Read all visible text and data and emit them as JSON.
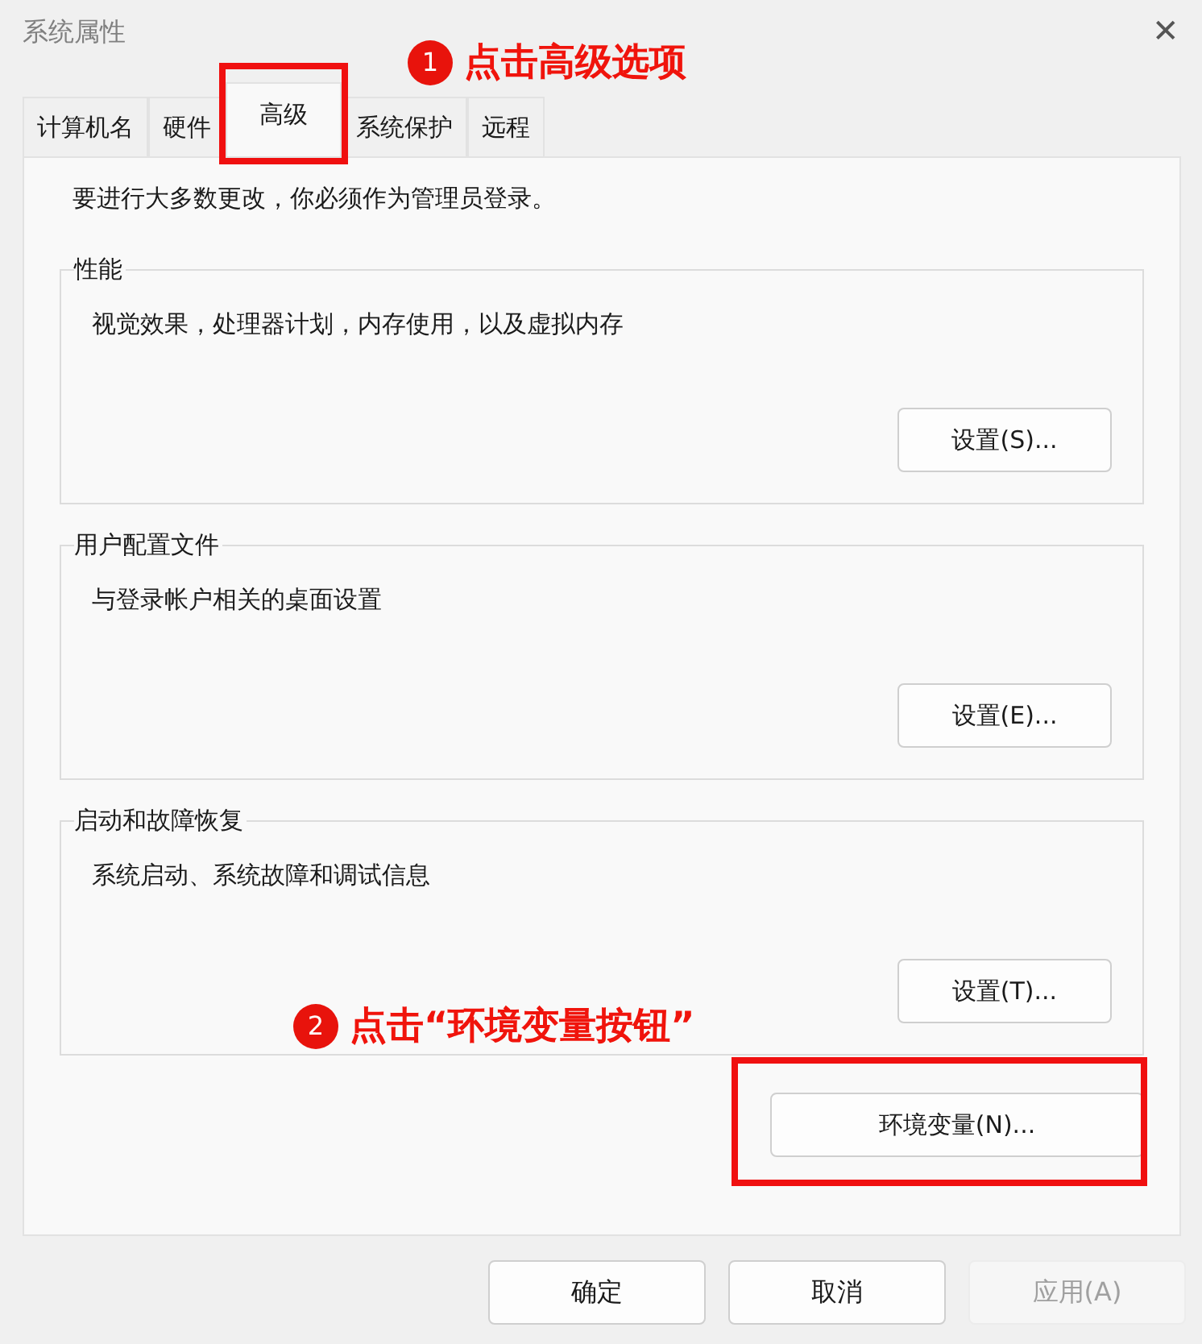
{
  "window": {
    "title": "系统属性",
    "close": "✕"
  },
  "tabs": [
    {
      "label": "计算机名",
      "selected": false
    },
    {
      "label": "硬件",
      "selected": false
    },
    {
      "label": "高级",
      "selected": true
    },
    {
      "label": "系统保护",
      "selected": false
    },
    {
      "label": "远程",
      "selected": false
    }
  ],
  "notice": "要进行大多数更改，你必须作为管理员登录。",
  "groups": [
    {
      "title": "性能",
      "description": "视觉效果，处理器计划，内存使用，以及虚拟内存",
      "button": "设置(S)..."
    },
    {
      "title": "用户配置文件",
      "description": "与登录帐户相关的桌面设置",
      "button": "设置(E)..."
    },
    {
      "title": "启动和故障恢复",
      "description": "系统启动、系统故障和调试信息",
      "button": "设置(T)..."
    }
  ],
  "env_button": "环境变量(N)...",
  "buttons": [
    {
      "label": "确定",
      "disabled": false
    },
    {
      "label": "取消",
      "disabled": false
    },
    {
      "label": "应用(A)",
      "disabled": true
    }
  ],
  "annotations": [
    {
      "number": "1",
      "text": "点击高级选项"
    },
    {
      "number": "2",
      "text": "点击“环境变量按钮”"
    }
  ]
}
